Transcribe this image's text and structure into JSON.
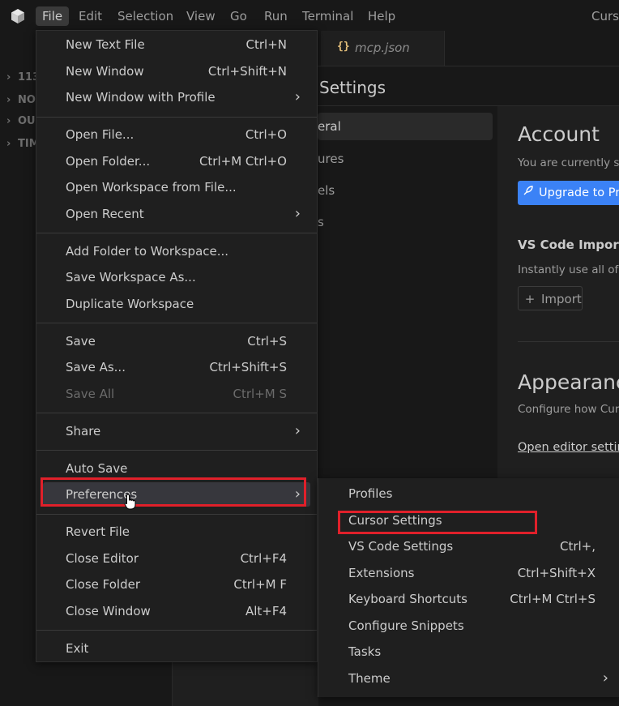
{
  "titlebar": {
    "menus": [
      "File",
      "Edit",
      "Selection",
      "View",
      "Go",
      "Run",
      "Terminal",
      "Help"
    ],
    "window_title": "Curs"
  },
  "sidebar": {
    "rows": [
      "113",
      "NO",
      "OU",
      "TIM"
    ]
  },
  "tabs": [
    {
      "icon": "{}",
      "label": "mcp.json"
    }
  ],
  "settings": {
    "header": "Settings",
    "nav": [
      "eral",
      "ures",
      "els",
      "s"
    ],
    "account_title": "Account",
    "account_text": "You are currently sign",
    "upgrade_label": "Upgrade to Pro",
    "vscode_import_title": "VS Code Import",
    "vscode_import_text": "Instantly use all of y",
    "import_label": "Import",
    "appearance_title": "Appearance",
    "appearance_text": "Configure how Curs",
    "editor_settings_link": "Open editor setting"
  },
  "file_menu": {
    "groups": [
      [
        {
          "label": "New Text File",
          "shortcut": "Ctrl+N"
        },
        {
          "label": "New Window",
          "shortcut": "Ctrl+Shift+N"
        },
        {
          "label": "New Window with Profile",
          "submenu": true
        }
      ],
      [
        {
          "label": "Open File...",
          "shortcut": "Ctrl+O"
        },
        {
          "label": "Open Folder...",
          "shortcut": "Ctrl+M Ctrl+O"
        },
        {
          "label": "Open Workspace from File..."
        },
        {
          "label": "Open Recent",
          "submenu": true
        }
      ],
      [
        {
          "label": "Add Folder to Workspace..."
        },
        {
          "label": "Save Workspace As..."
        },
        {
          "label": "Duplicate Workspace"
        }
      ],
      [
        {
          "label": "Save",
          "shortcut": "Ctrl+S"
        },
        {
          "label": "Save As...",
          "shortcut": "Ctrl+Shift+S"
        },
        {
          "label": "Save All",
          "shortcut": "Ctrl+M S",
          "disabled": true
        }
      ],
      [
        {
          "label": "Share",
          "submenu": true
        }
      ],
      [
        {
          "label": "Auto Save"
        },
        {
          "label": "Preferences",
          "submenu": true,
          "highlighted": true
        }
      ],
      [
        {
          "label": "Revert File"
        },
        {
          "label": "Close Editor",
          "shortcut": "Ctrl+F4"
        },
        {
          "label": "Close Folder",
          "shortcut": "Ctrl+M F"
        },
        {
          "label": "Close Window",
          "shortcut": "Alt+F4"
        }
      ],
      [
        {
          "label": "Exit"
        }
      ]
    ]
  },
  "preferences_menu": {
    "items": [
      {
        "label": "Profiles"
      },
      {
        "label": "Cursor Settings",
        "outlined": true
      },
      {
        "label": "VS Code Settings",
        "shortcut": "Ctrl+,"
      },
      {
        "label": "Extensions",
        "shortcut": "Ctrl+Shift+X"
      },
      {
        "label": "Keyboard Shortcuts",
        "shortcut": "Ctrl+M Ctrl+S"
      },
      {
        "label": "Configure Snippets"
      },
      {
        "label": "Tasks"
      },
      {
        "label": "Theme",
        "submenu": true
      }
    ]
  },
  "colors": {
    "highlight_outline": "#e0202a",
    "accent_button": "#3b82f6",
    "menu_bg": "#1f1f1f",
    "window_bg": "#181818"
  },
  "icons": {
    "app": "cursor-logo-icon",
    "submenu": "chevron-right-icon",
    "upgrade": "rocket-icon",
    "import": "plus-icon",
    "pointer": "hand-pointer-icon"
  }
}
